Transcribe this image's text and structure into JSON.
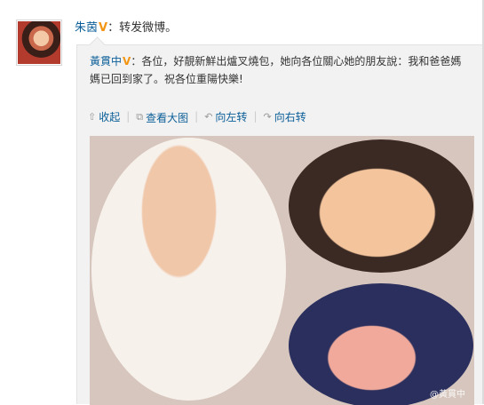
{
  "post": {
    "author": "朱茵",
    "badge": "V",
    "separator": "：",
    "text": "转发微博。"
  },
  "repost": {
    "author": "黃貫中",
    "badge": "V",
    "text": "：各位，好靚新鮮出爐叉燒包，她向各位關心她的朋友說：我和爸爸媽媽已回到家了。祝各位重陽快樂!"
  },
  "toolbar": {
    "collapse": "收起",
    "view_large": "查看大图",
    "rotate_left": "向左转",
    "rotate_right": "向右转",
    "sep": "|"
  },
  "photo": {
    "watermark": "@黃貫中"
  }
}
